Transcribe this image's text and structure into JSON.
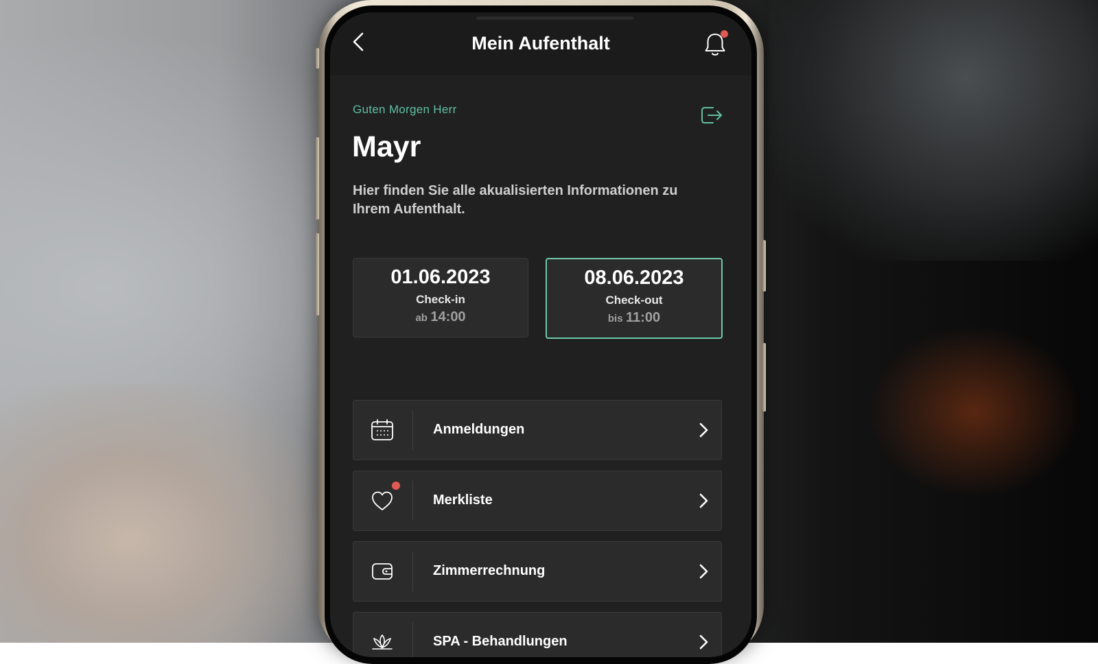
{
  "header": {
    "title": "Mein Aufenthalt"
  },
  "welcome": {
    "greeting": "Guten Morgen Herr",
    "name": "Mayr",
    "intro": "Hier finden Sie alle akualisierten Informationen zu Ihrem Aufenthalt."
  },
  "stay": {
    "checkin": {
      "date": "01.06.2023",
      "label": "Check-in",
      "prefix": "ab",
      "time": "14:00"
    },
    "checkout": {
      "date": "08.06.2023",
      "label": "Check-out",
      "prefix": "bis",
      "time": "11:00",
      "selected": true
    }
  },
  "menu": {
    "items": [
      {
        "label": "Anmeldungen",
        "icon": "calendar-icon"
      },
      {
        "label": "Merkliste",
        "icon": "heart-icon",
        "has_notification": true
      },
      {
        "label": "Zimmerrechnung",
        "icon": "wallet-icon"
      },
      {
        "label": "SPA - Behandlungen",
        "icon": "lotus-icon"
      }
    ]
  },
  "colors": {
    "accent": "#5fc0a3",
    "notification": "#e05a53",
    "background": "#202020",
    "card": "#2b2b2b"
  },
  "icons": {
    "back": "chevron-left-icon",
    "notifications": "bell-icon",
    "logout": "logout-icon",
    "row_action": "chevron-right-icon"
  }
}
